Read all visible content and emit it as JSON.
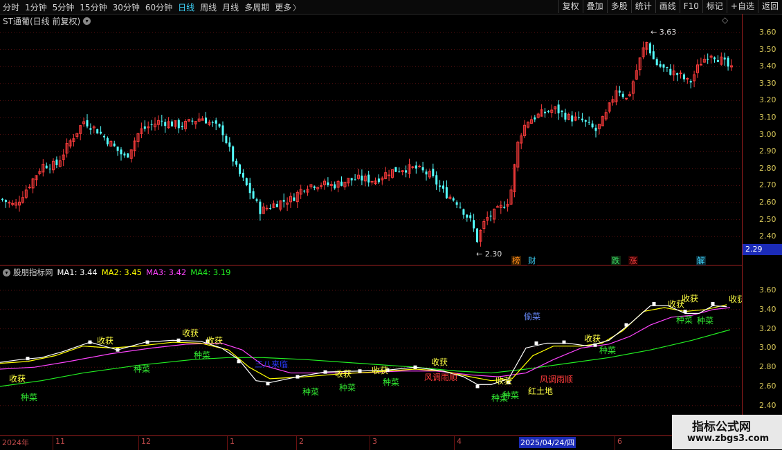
{
  "toolbar": {
    "periods": [
      "分时",
      "1分钟",
      "5分钟",
      "15分钟",
      "30分钟",
      "60分钟",
      "日线",
      "周线",
      "月线",
      "多周期",
      "更多"
    ],
    "active_period": "日线",
    "buttons": [
      "复权",
      "叠加",
      "多股",
      "统计",
      "画线",
      "F10",
      "标记",
      "+自选",
      "返回"
    ]
  },
  "main_chart": {
    "title": "ST通葡(日线 前复权)",
    "high_label": "3.63",
    "low_label": "2.30",
    "current_price": "2.29",
    "y_ticks": [
      "3.60",
      "3.50",
      "3.40",
      "3.30",
      "3.20",
      "3.10",
      "3.00",
      "2.90",
      "2.80",
      "2.70",
      "2.60",
      "2.50",
      "2.40"
    ],
    "events": [
      {
        "label": "榜",
        "color": "#ff8c1a",
        "bg": "#3a1f00"
      },
      {
        "label": "财",
        "color": "#3fd7ff",
        "bg": "#000"
      },
      {
        "label": "跌",
        "color": "#3fe86b",
        "bg": "#0d2a10"
      },
      {
        "label": "涨",
        "color": "#ff4040",
        "bg": "#2a0000"
      },
      {
        "label": "解",
        "color": "#3fd7ff",
        "bg": "#0b2a35"
      }
    ]
  },
  "indicator": {
    "name": "股朋指标网",
    "ma1": "MA1: 3.44",
    "ma2": "MA2: 3.45",
    "ma3": "MA3: 3.42",
    "ma4": "MA4: 3.19",
    "colors": {
      "ma1": "#ffffff",
      "ma2": "#ffff00",
      "ma3": "#ff44ff",
      "ma4": "#22ee22"
    },
    "y_ticks": [
      "3.60",
      "3.40",
      "3.20",
      "3.00",
      "2.80",
      "2.60",
      "2.40"
    ],
    "signals": {
      "harvest": "收获",
      "plant": "种菜",
      "steal": "偷菜",
      "good_weather": "风调雨顺",
      "red_land": "红土地",
      "overlap": "三八来临"
    }
  },
  "x_axis": {
    "labels": [
      "2024年",
      "11",
      "12",
      "1",
      "2",
      "3",
      "4",
      "2025/04/24/四",
      "6"
    ]
  },
  "watermark": {
    "line1": "指标公式网",
    "line2": "www.zbgs3.com"
  }
}
